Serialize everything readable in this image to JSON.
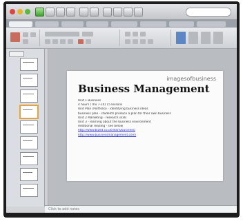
{
  "window": {
    "search_placeholder": ""
  },
  "slide": {
    "brand_tag": "imagesofbusiness",
    "title": "Business Management",
    "bullets": [
      "Unit 1 Business",
      "4 hours (Thu 7-10) 15 lessons",
      "Unit Plan (Portfolio) - identifying business ideas",
      "business plan - students produce a plan for their own business",
      "Unit 2 Marketing - research skills",
      "Unit 3 - learning about the business environment",
      "Additional reading - see below"
    ],
    "links": [
      "http://www.bized.co.uk/learn/business/",
      "http://www.businessmanagement.com/"
    ]
  },
  "notes": {
    "placeholder": "Click to add notes"
  },
  "colors": {
    "accent": "#e7a23a",
    "link": "#2b33c4"
  }
}
